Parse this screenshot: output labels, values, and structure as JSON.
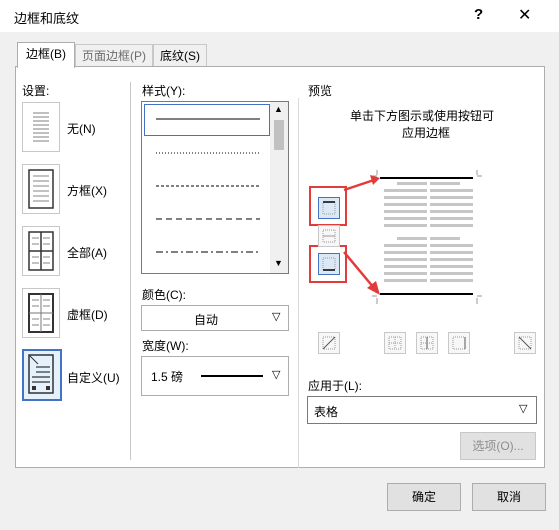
{
  "window": {
    "title": "边框和底纹",
    "help": "?",
    "close": "✕"
  },
  "tabs": [
    {
      "label": "边框(B)"
    },
    {
      "label": "页面边框(P)"
    },
    {
      "label": "底纹(S)"
    }
  ],
  "settings": {
    "heading": "设置:",
    "items": [
      {
        "label": "无(N)"
      },
      {
        "label": "方框(X)"
      },
      {
        "label": "全部(A)"
      },
      {
        "label": "虚框(D)"
      },
      {
        "label": "自定义(U)"
      }
    ],
    "selected": "自定义(U)"
  },
  "style": {
    "heading": "样式(Y):",
    "lines": [
      "solid",
      "dotted-fine",
      "dashed-small",
      "dashed",
      "dash-dot",
      "dash-dot-dot"
    ]
  },
  "color": {
    "heading": "颜色(C):",
    "value": "自动"
  },
  "width": {
    "heading": "宽度(W):",
    "value": "1.5 磅"
  },
  "preview": {
    "heading": "预览",
    "instruction_line1": "单击下方图示或使用按钮可",
    "instruction_line2": "应用边框"
  },
  "apply_to": {
    "heading": "应用于(L):",
    "value": "表格"
  },
  "buttons": {
    "options": "选项(O)...",
    "ok": "确定",
    "cancel": "取消"
  },
  "colors": {
    "accent": "#4472c4",
    "highlight": "#e23b3b"
  }
}
